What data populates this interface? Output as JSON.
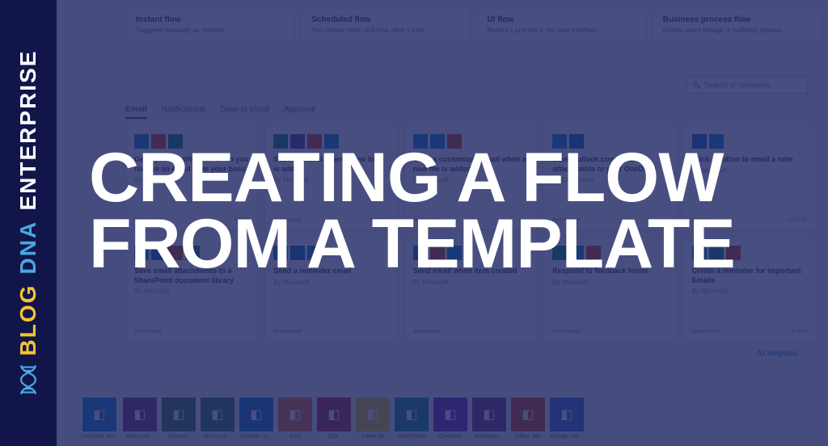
{
  "sidebar": {
    "brand_part1": "ENTERPRISE",
    "brand_part2": "DNA",
    "brand_part3": "BLOG"
  },
  "overlay_title": "CREATING A FLOW FROM A TEMPLATE",
  "flow_types": [
    {
      "title": "Instant flow",
      "desc": "Triggered manually as needed."
    },
    {
      "title": "Scheduled flow",
      "desc": "You choose when and how often it runs."
    },
    {
      "title": "UI flow",
      "desc": "Record a process in the user interface."
    },
    {
      "title": "Business process flow",
      "desc": "Guides users through a multistep process."
    }
  ],
  "search": {
    "placeholder": "Search all templates"
  },
  "tabs": [
    {
      "label": "Email",
      "active": true
    },
    {
      "label": "Notifications",
      "active": false
    },
    {
      "label": "Save to cloud",
      "active": false
    },
    {
      "label": "Approval",
      "active": false
    }
  ],
  "templates": [
    {
      "title": "Get a push notification when you receive an email from your boss",
      "author": "By Microsoft",
      "type": "Automated",
      "count": "43618",
      "icons": [
        "blue",
        "red",
        "teal"
      ]
    },
    {
      "title": "Start approval when a new item is added",
      "author": "By Microsoft",
      "type": "Automated",
      "count": "249810",
      "icons": [
        "teal",
        "purple",
        "red",
        "blue"
      ]
    },
    {
      "title": "Send a customized email when a new file is added",
      "author": "By Microsoft",
      "type": "Automated",
      "count": "",
      "icons": [
        "blue",
        "blue",
        "red"
      ]
    },
    {
      "title": "Save Outlook.com email attachments to your OneDrive",
      "author": "By Community",
      "type": "Automated",
      "count": "",
      "icons": [
        "blue",
        "blue2"
      ]
    },
    {
      "title": "Click a button to email a note",
      "author": "By Microsoft",
      "type": "Instant",
      "count": "123336",
      "icons": [
        "blue2",
        "blue"
      ]
    },
    {
      "title": "Save email attachments to a SharePoint document library",
      "author": "By Microsoft",
      "type": "Automated",
      "count": "",
      "icons": [
        "blue",
        "blue2",
        "red",
        "teal"
      ]
    },
    {
      "title": "Send a reminder email",
      "author": "By Microsoft",
      "type": "Automated",
      "count": "",
      "icons": [
        "blue",
        "blue2",
        "blue"
      ]
    },
    {
      "title": "Send email when item created",
      "author": "By Microsoft",
      "type": "Automated",
      "count": "",
      "icons": [
        "blue",
        "red",
        "blue"
      ]
    },
    {
      "title": "Respond to feedback forms",
      "author": "By Microsoft",
      "type": "Automated",
      "count": "",
      "icons": [
        "teal",
        "blue",
        "red"
      ]
    },
    {
      "title": "Create a reminder for important Emails",
      "author": "By Microsoft",
      "type": "Automated",
      "count": "37983",
      "icons": [
        "blue",
        "teal",
        "red"
      ]
    }
  ],
  "all_templates_link": "All templates →",
  "app_icons": [
    {
      "label": "OneDrive Bu...",
      "color": "#0078d4"
    },
    {
      "label": "Microsoft...",
      "color": "#742774"
    },
    {
      "label": "Planner",
      "color": "#31752f"
    },
    {
      "label": "Microsoft...",
      "color": "#217346"
    },
    {
      "label": "Outlook.co...",
      "color": "#0072c6"
    },
    {
      "label": "RSS",
      "color": "#f26522"
    },
    {
      "label": "SQL",
      "color": "#b01f24"
    },
    {
      "label": "Power BI",
      "color": "#f2c811"
    },
    {
      "label": "SharePoint",
      "color": "#038387"
    },
    {
      "label": "OneNote",
      "color": "#7719aa"
    },
    {
      "label": "Notificatio...",
      "color": "#742774"
    },
    {
      "label": "Office 365",
      "color": "#d83b01"
    },
    {
      "label": "Google Cal...",
      "color": "#3367d6"
    }
  ]
}
